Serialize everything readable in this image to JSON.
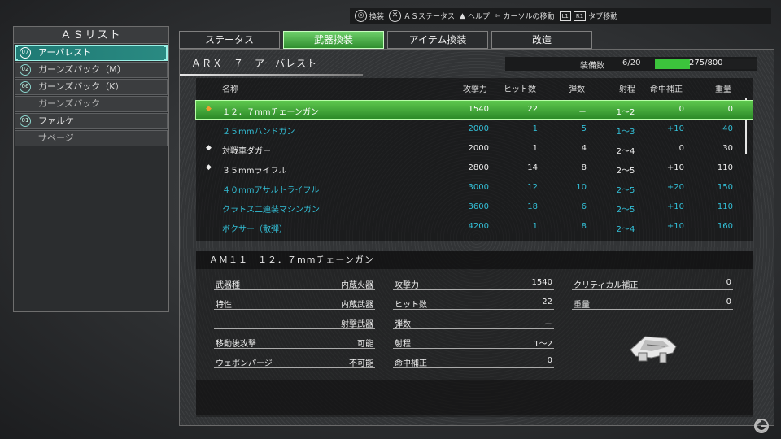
{
  "hints": [
    {
      "icon": "◎",
      "label": "換装"
    },
    {
      "icon": "✕",
      "label": "ＡＳステータス"
    },
    {
      "icon": "▲",
      "label": "ヘルプ"
    },
    {
      "icon": "⇦",
      "label": "カーソルの移動"
    },
    {
      "icon": "L1",
      "icon2": "R1",
      "label": "タブ移動"
    }
  ],
  "aslist": {
    "title": "ＡＳリスト",
    "items": [
      {
        "badge": "07",
        "label": "アーバレスト",
        "selected": true
      },
      {
        "badge": "02",
        "label": "ガーンズバック（M）"
      },
      {
        "badge": "06",
        "label": "ガーンズバック（K）"
      },
      {
        "badge": "",
        "label": "ガーンズバック"
      },
      {
        "badge": "01",
        "label": "ファルケ"
      },
      {
        "badge": "",
        "label": "サベージ"
      }
    ]
  },
  "tabs": [
    {
      "label": "ステータス",
      "active": false
    },
    {
      "label": "武器換装",
      "active": true
    },
    {
      "label": "アイテム換装",
      "active": false
    },
    {
      "label": "改造",
      "active": false
    }
  ],
  "unit": {
    "name": "ＡＲＸ－７　アーバレスト",
    "capacity_label": "装備数",
    "capacity_count": "6/20",
    "load_value": "275/800",
    "load_fraction": 0.344,
    "load_color": "#3cc43c"
  },
  "weapon_table": {
    "headers": {
      "name": "名称",
      "atk": "攻撃力",
      "hit": "ヒット数",
      "ammo": "弾数",
      "range": "射程",
      "acc": "命中補正",
      "wt": "重量"
    },
    "rows": [
      {
        "bullet": "◆",
        "name": "１２．７mmチェーンガン",
        "atk": "1540",
        "hit": "22",
        "ammo": "－",
        "range": "1～2",
        "acc": "0",
        "wt": "0",
        "style": "selected"
      },
      {
        "bullet": "",
        "name": "２５mmハンドガン",
        "atk": "2000",
        "hit": "1",
        "ammo": "5",
        "range": "1～3",
        "acc": "+10",
        "wt": "40",
        "style": "teal"
      },
      {
        "bullet": "◆",
        "name": "対戦車ダガー",
        "atk": "2000",
        "hit": "1",
        "ammo": "4",
        "range": "2～4",
        "acc": "0",
        "wt": "30",
        "style": "white"
      },
      {
        "bullet": "◆",
        "name": "３５mmライフル",
        "atk": "2800",
        "hit": "14",
        "ammo": "8",
        "range": "2～5",
        "acc": "+10",
        "wt": "110",
        "style": "white"
      },
      {
        "bullet": "",
        "name": "４０mmアサルトライフル",
        "atk": "3000",
        "hit": "12",
        "ammo": "10",
        "range": "2～5",
        "acc": "+20",
        "wt": "150",
        "style": "teal"
      },
      {
        "bullet": "",
        "name": "クラトス二連装マシンガン",
        "atk": "3600",
        "hit": "18",
        "ammo": "6",
        "range": "2～5",
        "acc": "+10",
        "wt": "110",
        "style": "teal"
      },
      {
        "bullet": "",
        "name": "ボクサー（散弾）",
        "atk": "4200",
        "hit": "1",
        "ammo": "8",
        "range": "2～4",
        "acc": "+10",
        "wt": "160",
        "style": "teal"
      }
    ]
  },
  "detail": {
    "title": "ＡＭ１１　１２．７mmチェーンガン",
    "col1": [
      {
        "k": "武器種",
        "v": "内蔵火器"
      },
      {
        "k": "特性",
        "v": "内蔵武器"
      },
      {
        "k": "",
        "v": "射撃武器"
      },
      {
        "k": "移動後攻撃",
        "v": "可能"
      },
      {
        "k": "ウェポンパージ",
        "v": "不可能"
      }
    ],
    "col2": [
      {
        "k": "攻撃力",
        "v": "1540"
      },
      {
        "k": "ヒット数",
        "v": "22"
      },
      {
        "k": "弾数",
        "v": "－"
      },
      {
        "k": "射程",
        "v": "1～2"
      },
      {
        "k": "命中補正",
        "v": "0"
      }
    ],
    "col3": [
      {
        "k": "クリティカル補正",
        "v": "0"
      },
      {
        "k": "重量",
        "v": "0"
      }
    ]
  }
}
